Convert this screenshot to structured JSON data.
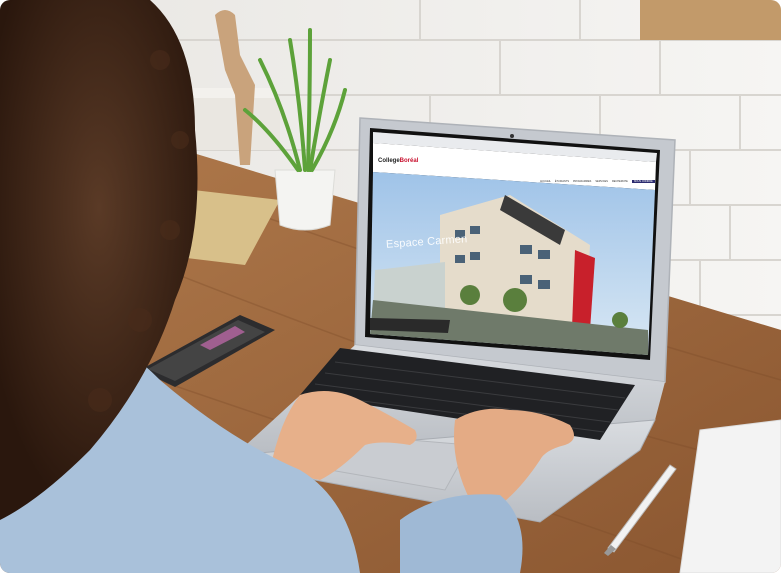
{
  "photo": {
    "subject": "person-using-laptop",
    "colors": {
      "wall": "#f1f0ee",
      "desk": "#a0683c",
      "hair": "#3a2316",
      "shirt": "#9bb6d3",
      "laptop": "#cdd1d6",
      "screen_sky": "#8fb4dc"
    }
  },
  "laptop_screen": {
    "brand_prefix": "College",
    "brand_accent": "Boréal",
    "hero_title": "Espace Carmen",
    "menu": [
      "ACCUEIL",
      "ÉTUDIANTS",
      "PROGRAMMES",
      "SERVICES",
      "RECHERCHE",
      "NOUS JOINDRE"
    ]
  }
}
